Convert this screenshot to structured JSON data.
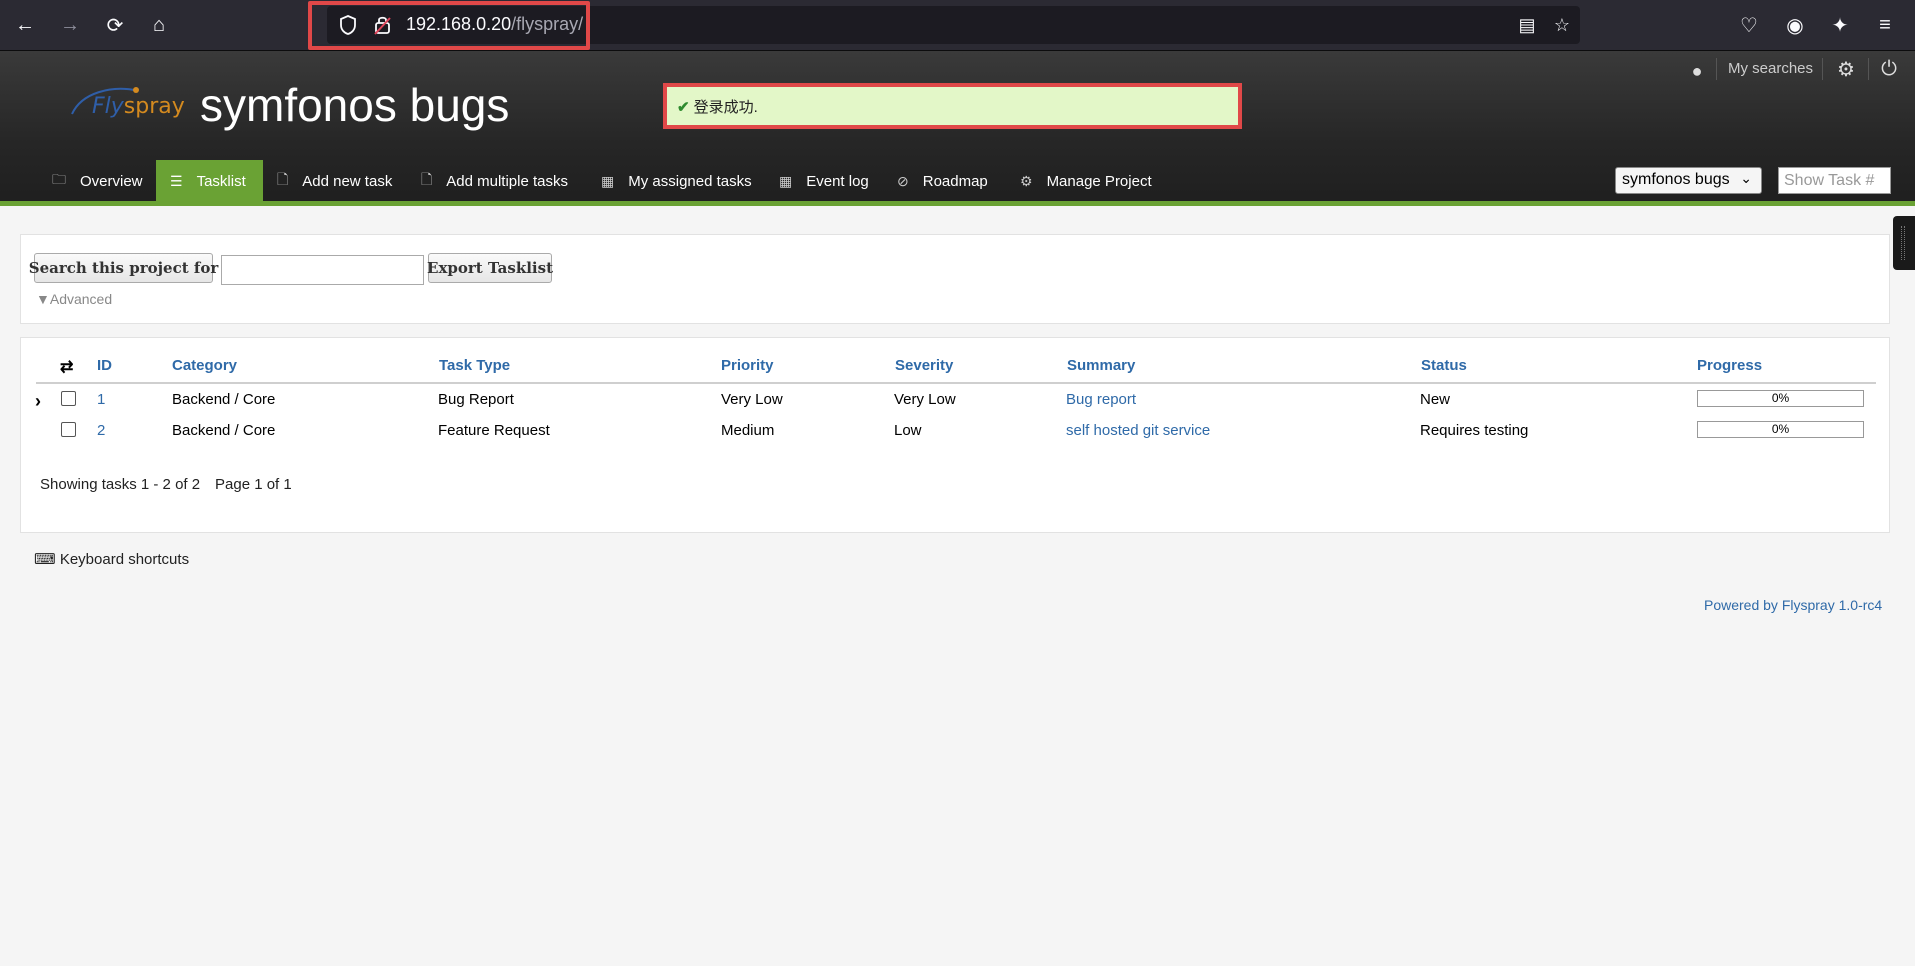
{
  "browser": {
    "url_host": "192.168.0.20",
    "url_path": "/flyspray/"
  },
  "header": {
    "logo_fly": "Fly",
    "logo_spray": "spray",
    "site_title": "symfonos bugs",
    "success_message": "登录成功.",
    "my_searches": "My searches"
  },
  "tabs": [
    {
      "label": "Overview",
      "icon": "folder-icon"
    },
    {
      "label": "Tasklist",
      "icon": "list-icon"
    },
    {
      "label": "Add new task",
      "icon": "file-icon"
    },
    {
      "label": "Add multiple tasks",
      "icon": "file-icon"
    },
    {
      "label": "My assigned tasks",
      "icon": "calendar-icon"
    },
    {
      "label": "Event log",
      "icon": "calendar-icon"
    },
    {
      "label": "Roadmap",
      "icon": "compass-icon"
    },
    {
      "label": "Manage Project",
      "icon": "gear-icon"
    }
  ],
  "project_select": {
    "value": "symfonos bugs"
  },
  "show_task": {
    "placeholder": "Show Task #"
  },
  "search": {
    "button_label": "Search this project for",
    "export_label": "Export Tasklist",
    "advanced_label": "▼Advanced"
  },
  "table": {
    "headers": [
      "ID",
      "Category",
      "Task Type",
      "Priority",
      "Severity",
      "Summary",
      "Status",
      "Progress"
    ],
    "rows": [
      {
        "id": "1",
        "category": "Backend / Core",
        "task_type": "Bug Report",
        "priority": "Very Low",
        "severity": "Very Low",
        "summary": "Bug report",
        "status": "New",
        "progress": "0%"
      },
      {
        "id": "2",
        "category": "Backend / Core",
        "task_type": "Feature Request",
        "priority": "Medium",
        "severity": "Low",
        "summary": "self hosted git service",
        "status": "Requires testing",
        "progress": "0%"
      }
    ],
    "showing": "Showing tasks 1 - 2 of 2",
    "page": "Page 1 of 1"
  },
  "footer": {
    "shortcuts": "Keyboard shortcuts",
    "powered": "Powered by Flyspray 1.0-rc4"
  }
}
